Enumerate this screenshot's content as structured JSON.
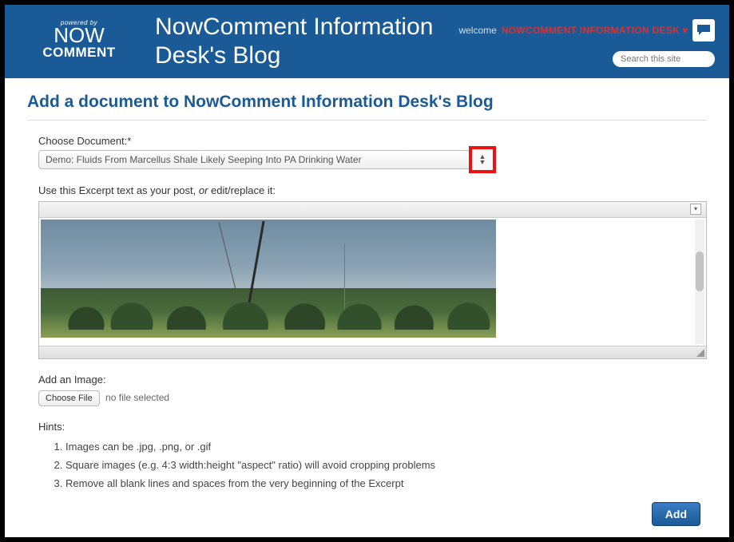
{
  "header": {
    "powered_by": "powered by",
    "logo_now": "NOW",
    "logo_comment": "COMMENT",
    "title": "NowComment Information Desk's Blog",
    "welcome": "welcome",
    "user_link": "NOWCOMMENT INFORMATION DESK",
    "caret": "▾",
    "search_placeholder": "Search this site"
  },
  "page": {
    "heading": "Add a document to NowComment Information Desk's Blog"
  },
  "form": {
    "choose_label": "Choose Document:*",
    "choose_value": "Demo: Fluids From Marcellus Shale Likely Seeping Into PA Drinking Water",
    "excerpt_label_a": "Use this Excerpt text as your post, ",
    "excerpt_label_or": "or",
    "excerpt_label_b": " edit/replace it:",
    "add_image_label": "Add an Image:",
    "choose_file_btn": "Choose File",
    "no_file": "no file selected",
    "hints_label": "Hints:",
    "hints": [
      "Images can be .jpg, .png, or .gif",
      "Square images (e.g. 4:3 width:height \"aspect\" ratio) will avoid cropping problems",
      "Remove all blank lines and spaces from the very beginning of the Excerpt"
    ],
    "add_btn": "Add"
  }
}
